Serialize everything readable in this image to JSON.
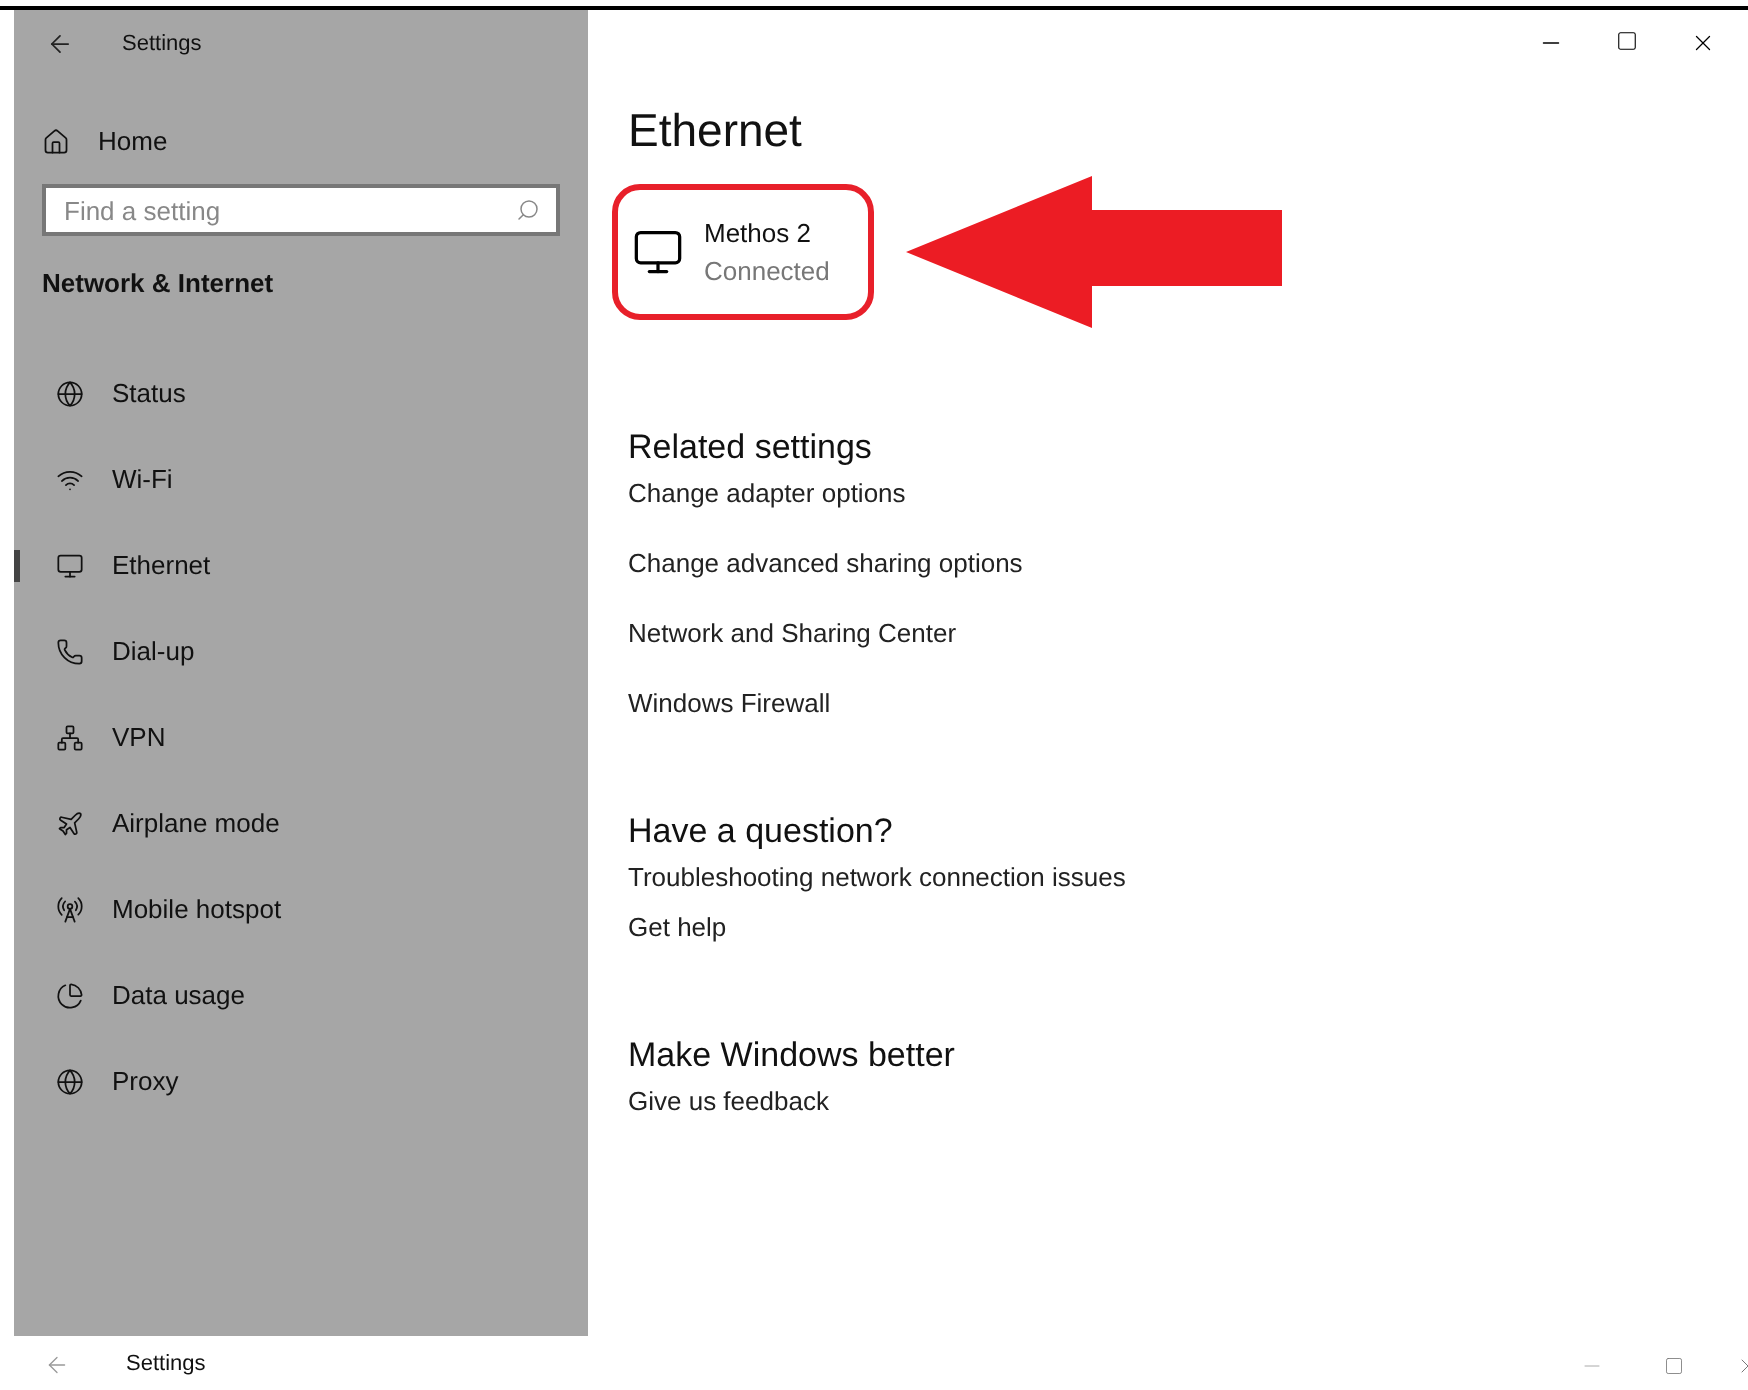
{
  "window": {
    "title": "Settings"
  },
  "sidebar": {
    "home": "Home",
    "search": {
      "placeholder": "Find a setting"
    },
    "section": "Network & Internet",
    "items": [
      {
        "label": "Status",
        "selected": false
      },
      {
        "label": "Wi-Fi",
        "selected": false
      },
      {
        "label": "Ethernet",
        "selected": true
      },
      {
        "label": "Dial-up",
        "selected": false
      },
      {
        "label": "VPN",
        "selected": false
      },
      {
        "label": "Airplane mode",
        "selected": false
      },
      {
        "label": "Mobile hotspot",
        "selected": false
      },
      {
        "label": "Data usage",
        "selected": false
      },
      {
        "label": "Proxy",
        "selected": false
      }
    ]
  },
  "main": {
    "title": "Ethernet",
    "connection": {
      "name": "Methos 2",
      "status": "Connected"
    },
    "sections": [
      {
        "heading": "Related settings",
        "links": [
          "Change adapter options",
          "Change advanced sharing options",
          "Network and Sharing Center",
          "Windows Firewall"
        ]
      },
      {
        "heading": "Have a question?",
        "links": [
          "Troubleshooting network connection issues",
          "Get help"
        ]
      },
      {
        "heading": "Make Windows better",
        "links": [
          "Give us feedback"
        ]
      }
    ]
  },
  "second_window": {
    "title": "Settings"
  }
}
